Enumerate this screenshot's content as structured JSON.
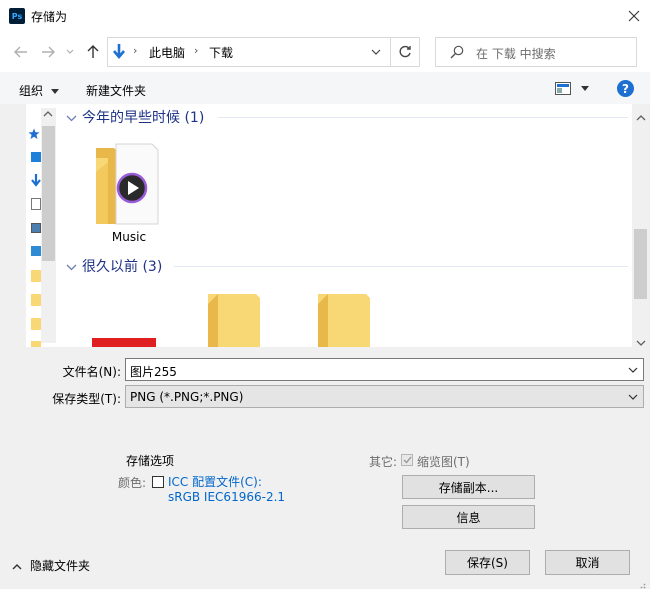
{
  "window": {
    "title": "存储为",
    "app_icon_text": "Ps"
  },
  "nav": {
    "breadcrumb": [
      "此电脑",
      "下载"
    ],
    "search_placeholder": "在 下载 中搜索"
  },
  "toolbar": {
    "organize_label": "组织",
    "new_folder_label": "新建文件夹"
  },
  "groups": [
    {
      "header": "今年的早些时候 (1)",
      "items": [
        {
          "name": "Music",
          "icon": "music-folder-icon"
        }
      ]
    },
    {
      "header": "很久以前 (3)",
      "items": [
        {
          "name": "",
          "icon": "image-thumbnail-icon"
        },
        {
          "name": "",
          "icon": "folder-icon"
        },
        {
          "name": "",
          "icon": "folder-icon"
        }
      ]
    }
  ],
  "form": {
    "filename_label": "文件名(N):",
    "filename_value": "图片255",
    "filetype_label": "保存类型(T):",
    "filetype_value": "PNG (*.PNG;*.PNG)"
  },
  "options": {
    "section_title": "存储选项",
    "color_label": "颜色:",
    "icc_label": "ICC 配置文件(C):",
    "icc_value": "sRGB IEC61966-2.1",
    "other_label": "其它:",
    "thumbnail_label": "缩览图(T)",
    "save_copy_label": "存储副本...",
    "info_label": "信息"
  },
  "footer": {
    "hide_folders_label": "隐藏文件夹",
    "save_label": "保存(S)",
    "cancel_label": "取消"
  },
  "colors": {
    "accent": "#1e6fd2",
    "group_header": "#1e3287",
    "folder_yellow": "#f8d775",
    "link": "#0066cc"
  }
}
